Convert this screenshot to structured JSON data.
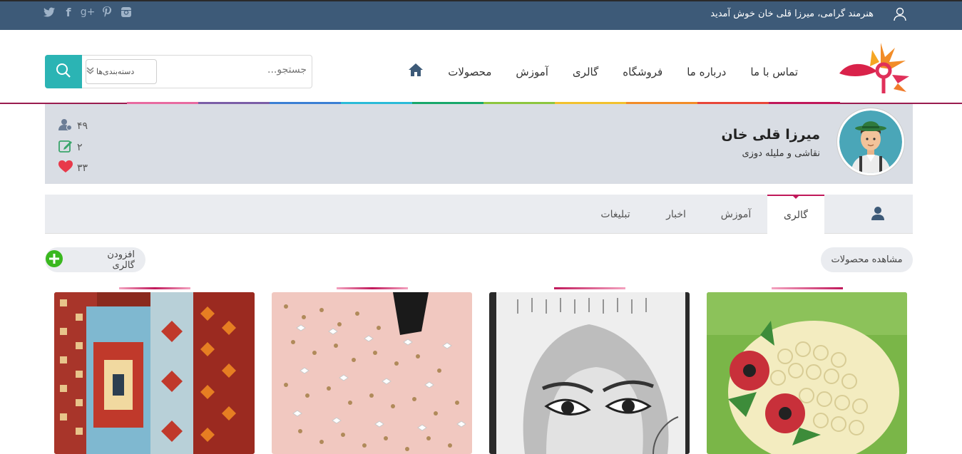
{
  "topbar": {
    "welcome": "هنرمند گرامی، میرزا قلی خان خوش آمدید",
    "social": [
      {
        "icon": "instagram-icon",
        "glyph": "◙"
      },
      {
        "icon": "pinterest-icon",
        "glyph": "℗"
      },
      {
        "icon": "googleplus-icon",
        "glyph": "g+"
      },
      {
        "icon": "facebook-icon",
        "glyph": "f"
      },
      {
        "icon": "twitter-icon",
        "glyph": "🐦"
      }
    ]
  },
  "nav": {
    "items": [
      "محصولات",
      "آموزش",
      "گالری",
      "فروشگاه",
      "درباره ما",
      "تماس با ما"
    ]
  },
  "search": {
    "placeholder": "جستجو...",
    "category_label": "دسته‌بندی‌ها"
  },
  "profile": {
    "name": "میرزا قلی خان",
    "subtitle": "نقاشی و ملیله دوزی",
    "stats": {
      "followers": "۴۹",
      "posts": "۲",
      "likes": "۳۳"
    }
  },
  "tabs": {
    "gallery": "گالری",
    "tutorial": "آموزش",
    "news": "اخبار",
    "ads": "تبلیغات"
  },
  "actions": {
    "view_products": "مشاهده محصولات",
    "add_gallery": "افزودن گالری"
  },
  "colors": {
    "topbar": "#3d5a78",
    "accent": "#2bb4b4",
    "active_tab": "#c0185a",
    "profile_bg": "#d9dde4"
  }
}
